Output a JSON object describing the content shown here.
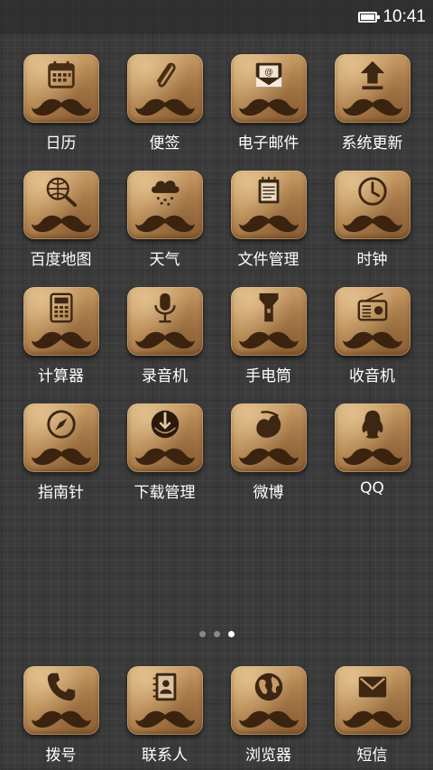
{
  "status_bar": {
    "time": "10:41",
    "battery_icon": "battery-full-icon"
  },
  "apps": [
    {
      "label": "日历",
      "icon": "calendar-icon"
    },
    {
      "label": "便签",
      "icon": "paperclip-icon"
    },
    {
      "label": "电子邮件",
      "icon": "email-icon"
    },
    {
      "label": "系统更新",
      "icon": "upload-arrow-icon"
    },
    {
      "label": "百度地图",
      "icon": "globe-search-icon"
    },
    {
      "label": "天气",
      "icon": "weather-cloud-icon"
    },
    {
      "label": "文件管理",
      "icon": "notepad-icon"
    },
    {
      "label": "时钟",
      "icon": "clock-icon"
    },
    {
      "label": "计算器",
      "icon": "calculator-icon"
    },
    {
      "label": "录音机",
      "icon": "microphone-icon"
    },
    {
      "label": "手电筒",
      "icon": "flashlight-icon"
    },
    {
      "label": "收音机",
      "icon": "radio-icon"
    },
    {
      "label": "指南针",
      "icon": "compass-icon"
    },
    {
      "label": "下载管理",
      "icon": "download-icon"
    },
    {
      "label": "微博",
      "icon": "weibo-icon"
    },
    {
      "label": "QQ",
      "icon": "qq-penguin-icon"
    }
  ],
  "page_indicator": {
    "pages": 3,
    "current": 3
  },
  "dock": [
    {
      "label": "拨号",
      "icon": "phone-icon"
    },
    {
      "label": "联系人",
      "icon": "contacts-book-icon"
    },
    {
      "label": "浏览器",
      "icon": "globe-icon"
    },
    {
      "label": "短信",
      "icon": "envelope-icon"
    }
  ]
}
